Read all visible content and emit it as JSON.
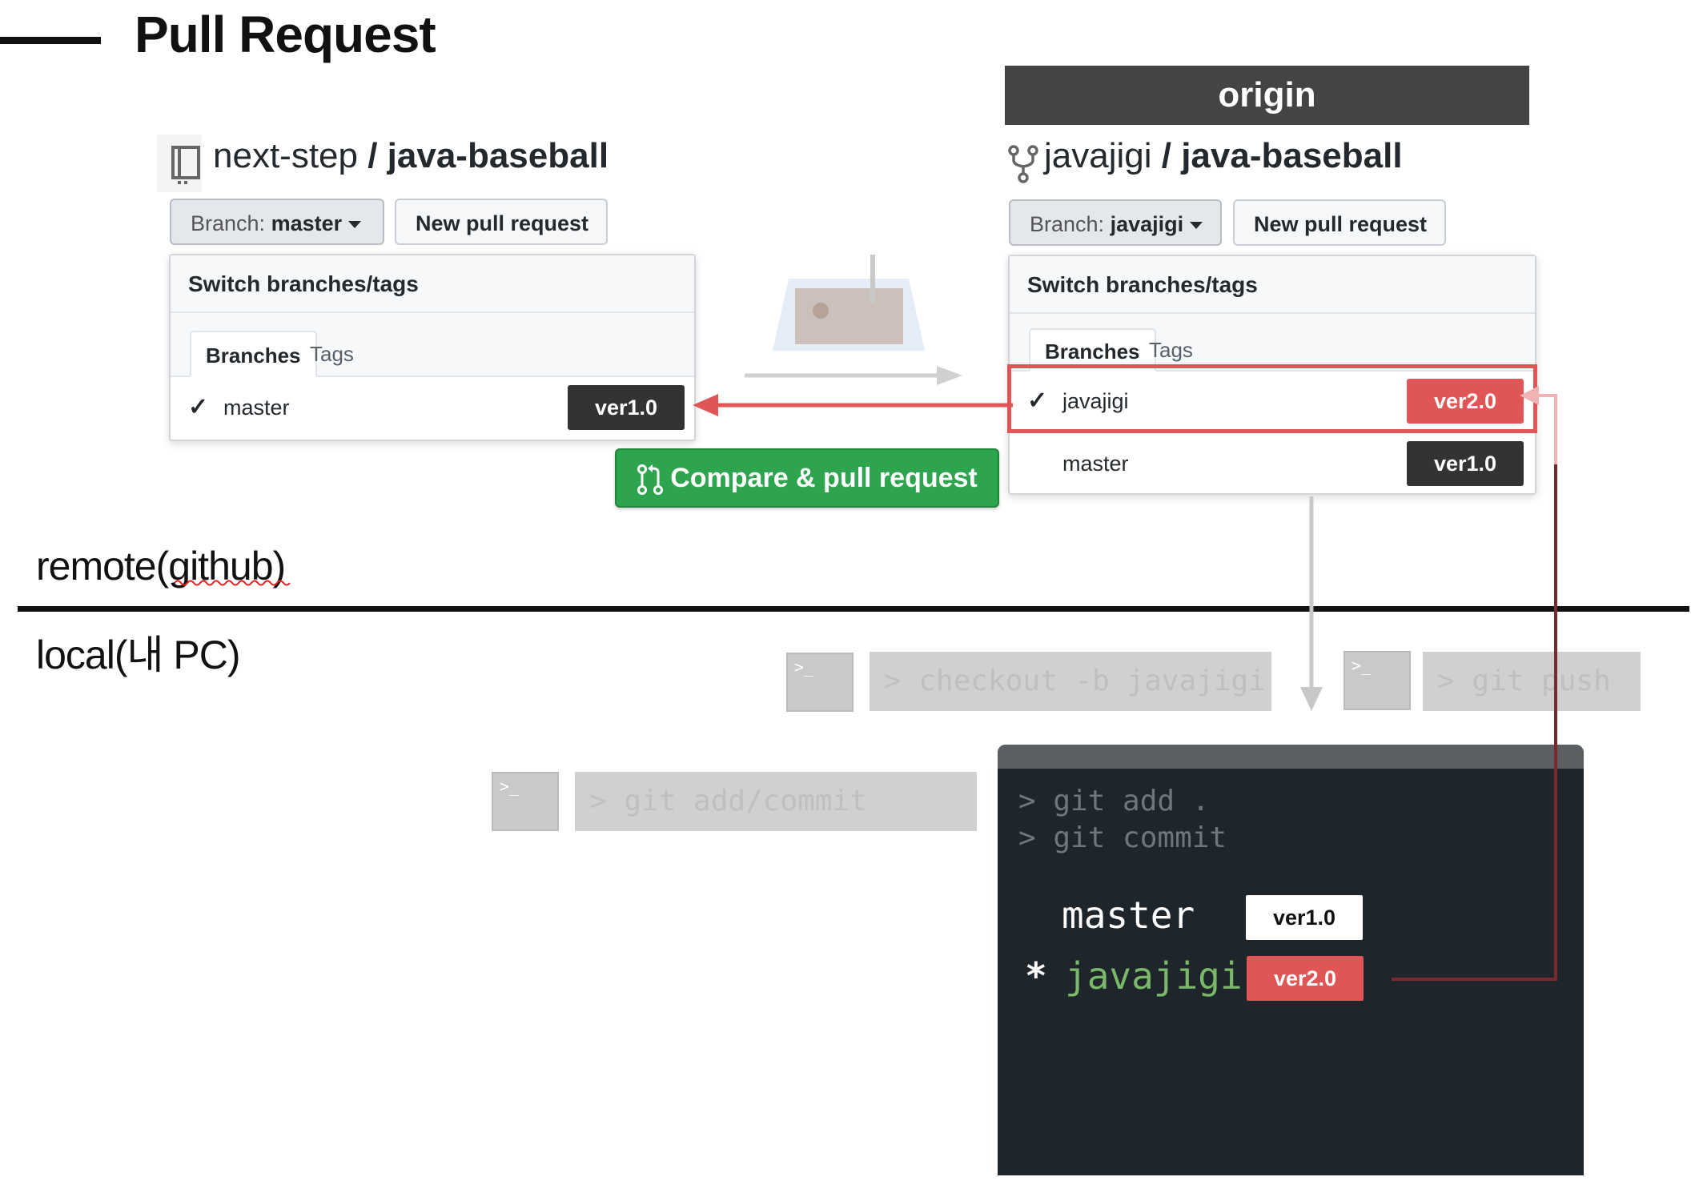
{
  "page": {
    "title": "Pull Request"
  },
  "origin": {
    "label": "origin"
  },
  "left_repo": {
    "owner": "next-step",
    "separator": " / ",
    "name": "java-baseball",
    "branch_button": {
      "prefix": "Branch:",
      "value": "master"
    },
    "new_pr_label": "New pull request",
    "dropdown": {
      "header": "Switch branches/tags",
      "tabs": [
        "Branches",
        "Tags"
      ],
      "rows": [
        {
          "label": "master",
          "tag": "ver1.0",
          "checked": true
        }
      ]
    }
  },
  "right_repo": {
    "owner": "javajigi",
    "separator": " / ",
    "name": "java-baseball",
    "branch_button": {
      "prefix": "Branch:",
      "value": "javajigi"
    },
    "new_pr_label": "New pull request",
    "dropdown": {
      "header": "Switch branches/tags",
      "tabs": [
        "Branches",
        "Tags"
      ],
      "rows": [
        {
          "label": "javajigi",
          "tag": "ver2.0",
          "checked": true,
          "tag_color": "#e05555"
        },
        {
          "label": "master",
          "tag": "ver1.0",
          "checked": false,
          "tag_color": "#333333"
        }
      ]
    }
  },
  "compare_button": {
    "label": "Compare & pull request",
    "color": "#2ea44f"
  },
  "sections": {
    "remote": "remote(github)",
    "local": "local(내 PC)"
  },
  "commands": {
    "checkout": "> checkout -b javajigi",
    "push": "> git push",
    "add_commit": "> git add/commit",
    "icon_text": ">_"
  },
  "terminal": {
    "lines": [
      "> git add .",
      "> git commit"
    ],
    "branches": [
      {
        "marker": "",
        "name": "master",
        "tag": "ver1.0",
        "tag_style": "white"
      },
      {
        "marker": "*",
        "name": "javajigi",
        "tag": "ver2.0",
        "tag_style": "red"
      }
    ]
  },
  "colors": {
    "accent_red": "#e05555",
    "dark_tag": "#333333",
    "terminal_bg": "#1e252b",
    "branch_green": "#7ab86a"
  }
}
